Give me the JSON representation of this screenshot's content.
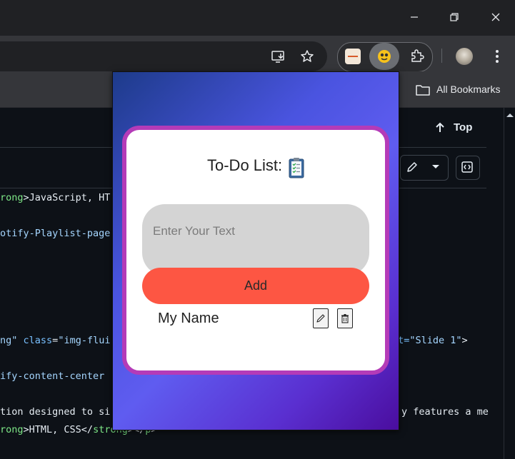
{
  "browser": {
    "bookmarks_label": "All Bookmarks"
  },
  "page": {
    "top_link": "Top",
    "code_lines": [
      {
        "parts": [
          {
            "t": "rong",
            "c": "green"
          },
          {
            "t": ">JavaScript, HT",
            "c": "plain"
          }
        ]
      },
      {
        "parts": [
          {
            "t": "otify-Playlist-page",
            "c": "blue"
          }
        ]
      },
      {
        "parts": [
          {
            "t": "ng\"",
            "c": "blue"
          },
          {
            "t": " class",
            "c": "attr"
          },
          {
            "t": "=",
            "c": "plain"
          },
          {
            "t": "\"img-flui",
            "c": "blue"
          }
        ]
      },
      {
        "parts": [
          {
            "t": "lt=",
            "c": "attr"
          },
          {
            "t": "\"Slide 1\"",
            "c": "blue"
          },
          {
            "t": ">",
            "c": "plain"
          }
        ]
      },
      {
        "parts": [
          {
            "t": "ify-content-center",
            "c": "blue"
          }
        ]
      },
      {
        "parts": [
          {
            "t": "tion designed to si",
            "c": "plain"
          }
        ]
      },
      {
        "parts": [
          {
            "t": "y features a me",
            "c": "plain"
          }
        ]
      },
      {
        "parts": [
          {
            "t": "rong",
            "c": "green"
          },
          {
            "t": ">HTML, CSS</",
            "c": "plain"
          },
          {
            "t": "strong",
            "c": "green"
          },
          {
            "t": "></",
            "c": "plain"
          },
          {
            "t": "p",
            "c": "green"
          },
          {
            "t": ">",
            "c": "plain"
          }
        ]
      }
    ]
  },
  "todo_app": {
    "title": "To-Do List:",
    "input_placeholder": "Enter Your Text",
    "input_value": "",
    "add_label": "Add",
    "tasks": [
      {
        "text": "My Name"
      }
    ]
  }
}
